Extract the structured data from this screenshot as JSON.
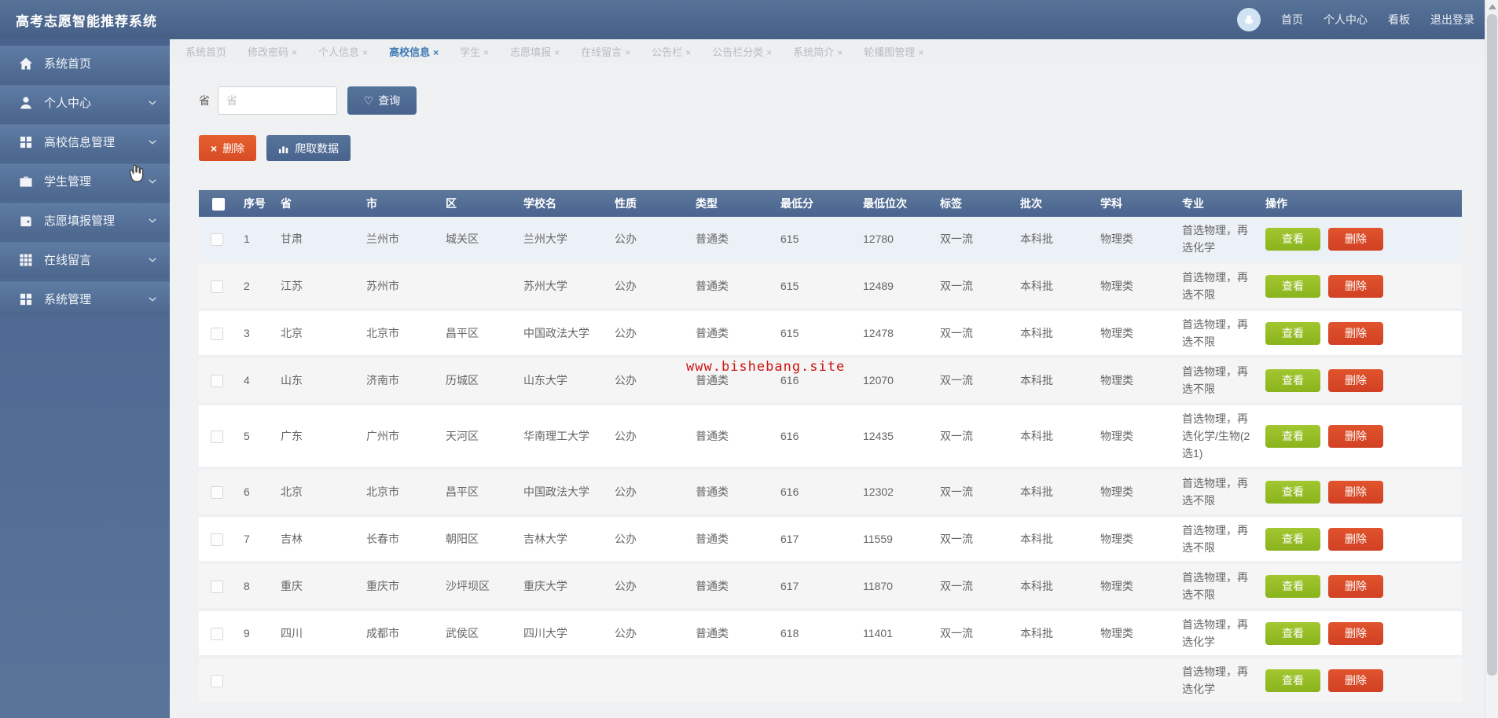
{
  "app": {
    "title": "高考志愿智能推荐系统"
  },
  "header": {
    "nav": {
      "home": "首页",
      "personal": "个人中心",
      "board": "看板",
      "logout": "退出登录"
    }
  },
  "sidebar": {
    "items": [
      {
        "name": "home",
        "label": "系统首页",
        "icon": "home-icon",
        "expandable": false
      },
      {
        "name": "personal-center",
        "label": "个人中心",
        "icon": "user-icon",
        "expandable": true
      },
      {
        "name": "university-info",
        "label": "高校信息管理",
        "icon": "grid-icon",
        "expandable": true
      },
      {
        "name": "student-mgmt",
        "label": "学生管理",
        "icon": "briefcase-icon",
        "expandable": true
      },
      {
        "name": "volunteer-mgmt",
        "label": "志愿填报管理",
        "icon": "wallet-icon",
        "expandable": true
      },
      {
        "name": "online-message",
        "label": "在线留言",
        "icon": "table-icon",
        "expandable": true
      },
      {
        "name": "system-mgmt",
        "label": "系统管理",
        "icon": "grid-icon",
        "expandable": true
      }
    ]
  },
  "tabs": [
    {
      "name": "system-home",
      "label": "系统首页",
      "closable": false,
      "active": false
    },
    {
      "name": "change-password",
      "label": "修改密码",
      "closable": true,
      "active": false
    },
    {
      "name": "personal-info",
      "label": "个人信息",
      "closable": true,
      "active": false
    },
    {
      "name": "university-info",
      "label": "高校信息",
      "closable": true,
      "active": true
    },
    {
      "name": "student",
      "label": "学生",
      "closable": true,
      "active": false
    },
    {
      "name": "volunteer",
      "label": "志愿填报",
      "closable": true,
      "active": false
    },
    {
      "name": "online-message",
      "label": "在线留言",
      "closable": true,
      "active": false
    },
    {
      "name": "bulletin",
      "label": "公告栏",
      "closable": true,
      "active": false
    },
    {
      "name": "bulletin-category",
      "label": "公告栏分类",
      "closable": true,
      "active": false
    },
    {
      "name": "system-intro",
      "label": "系统简介",
      "closable": true,
      "active": false
    },
    {
      "name": "carousel-mgmt",
      "label": "轮播图管理",
      "closable": true,
      "active": false
    }
  ],
  "search": {
    "label": "省",
    "placeholder": "省",
    "query_label": "查询"
  },
  "toolbar": {
    "delete_label": "删除",
    "crawl_label": "爬取数据"
  },
  "table": {
    "columns": [
      "",
      "序号",
      "省",
      "市",
      "区",
      "学校名",
      "性质",
      "类型",
      "最低分",
      "最低位次",
      "标签",
      "批次",
      "学科",
      "专业",
      "操作"
    ],
    "actions": {
      "view": "查看",
      "delete": "删除"
    },
    "rows": [
      {
        "seq": "1",
        "province": "甘肃",
        "city": "兰州市",
        "district": "城关区",
        "school": "兰州大学",
        "nature": "公办",
        "type": "普通类",
        "min_score": "615",
        "min_rank": "12780",
        "tag": "双一流",
        "batch": "本科批",
        "subject": "物理类",
        "major": "首选物理，再选化学",
        "highlighted": true
      },
      {
        "seq": "2",
        "province": "江苏",
        "city": "苏州市",
        "district": "",
        "school": "苏州大学",
        "nature": "公办",
        "type": "普通类",
        "min_score": "615",
        "min_rank": "12489",
        "tag": "双一流",
        "batch": "本科批",
        "subject": "物理类",
        "major": "首选物理，再选不限"
      },
      {
        "seq": "3",
        "province": "北京",
        "city": "北京市",
        "district": "昌平区",
        "school": "中国政法大学",
        "nature": "公办",
        "type": "普通类",
        "min_score": "615",
        "min_rank": "12478",
        "tag": "双一流",
        "batch": "本科批",
        "subject": "物理类",
        "major": "首选物理，再选不限"
      },
      {
        "seq": "4",
        "province": "山东",
        "city": "济南市",
        "district": "历城区",
        "school": "山东大学",
        "nature": "公办",
        "type": "普通类",
        "min_score": "616",
        "min_rank": "12070",
        "tag": "双一流",
        "batch": "本科批",
        "subject": "物理类",
        "major": "首选物理，再选不限"
      },
      {
        "seq": "5",
        "province": "广东",
        "city": "广州市",
        "district": "天河区",
        "school": "华南理工大学",
        "nature": "公办",
        "type": "普通类",
        "min_score": "616",
        "min_rank": "12435",
        "tag": "双一流",
        "batch": "本科批",
        "subject": "物理类",
        "major": "首选物理，再选化学/生物(2选1)"
      },
      {
        "seq": "6",
        "province": "北京",
        "city": "北京市",
        "district": "昌平区",
        "school": "中国政法大学",
        "nature": "公办",
        "type": "普通类",
        "min_score": "616",
        "min_rank": "12302",
        "tag": "双一流",
        "batch": "本科批",
        "subject": "物理类",
        "major": "首选物理，再选不限"
      },
      {
        "seq": "7",
        "province": "吉林",
        "city": "长春市",
        "district": "朝阳区",
        "school": "吉林大学",
        "nature": "公办",
        "type": "普通类",
        "min_score": "617",
        "min_rank": "11559",
        "tag": "双一流",
        "batch": "本科批",
        "subject": "物理类",
        "major": "首选物理，再选不限"
      },
      {
        "seq": "8",
        "province": "重庆",
        "city": "重庆市",
        "district": "沙坪坝区",
        "school": "重庆大学",
        "nature": "公办",
        "type": "普通类",
        "min_score": "617",
        "min_rank": "11870",
        "tag": "双一流",
        "batch": "本科批",
        "subject": "物理类",
        "major": "首选物理，再选不限"
      },
      {
        "seq": "9",
        "province": "四川",
        "city": "成都市",
        "district": "武侯区",
        "school": "四川大学",
        "nature": "公办",
        "type": "普通类",
        "min_score": "618",
        "min_rank": "11401",
        "tag": "双一流",
        "batch": "本科批",
        "subject": "物理类",
        "major": "首选物理，再选化学"
      },
      {
        "seq": "",
        "province": "",
        "city": "",
        "district": "",
        "school": "",
        "nature": "",
        "type": "",
        "min_score": "",
        "min_rank": "",
        "tag": "",
        "batch": "",
        "subject": "",
        "major": "首选物理，再选化学",
        "partial": true
      }
    ]
  },
  "watermark": "www.bishebang.site",
  "colors": {
    "header_bg": "#4d688e",
    "sidebar_bg": "#53709a",
    "table_header_bg": "#51698f",
    "accent_blue": "#4e6d99",
    "button_orange": "#e0542b",
    "button_green": "#94ba22",
    "button_red": "#d9472b",
    "active_tab": "#3e79b4",
    "watermark_red": "#cc1512"
  }
}
